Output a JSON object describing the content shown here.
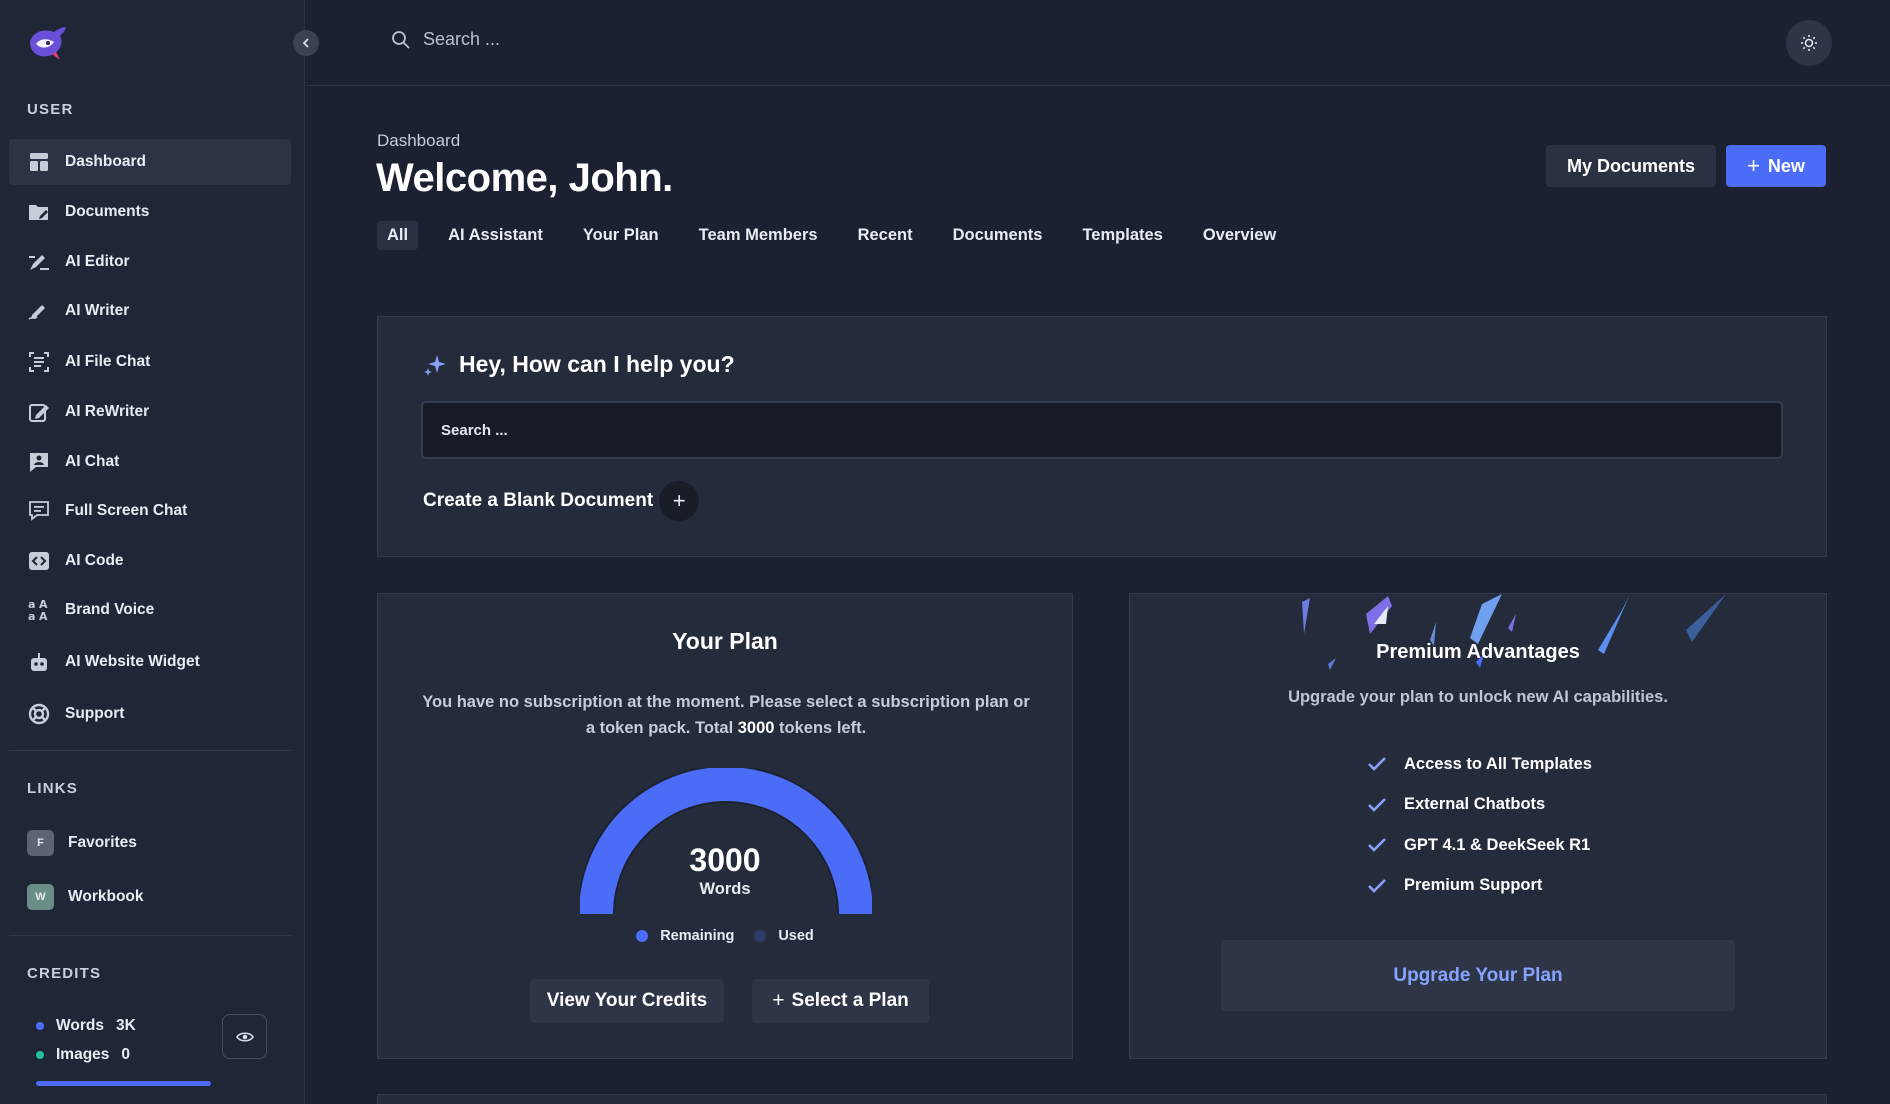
{
  "sidebar": {
    "user_title": "USER",
    "items": [
      {
        "label": "Dashboard",
        "icon": "dashboard-icon"
      },
      {
        "label": "Documents",
        "icon": "folder-icon"
      },
      {
        "label": "AI Editor",
        "icon": "editor-pen-icon"
      },
      {
        "label": "AI Writer",
        "icon": "writer-icon"
      },
      {
        "label": "AI File Chat",
        "icon": "file-chat-icon"
      },
      {
        "label": "AI ReWriter",
        "icon": "rewriter-icon"
      },
      {
        "label": "AI Chat",
        "icon": "chat-user-icon"
      },
      {
        "label": "Full Screen Chat",
        "icon": "fullscreen-chat-icon"
      },
      {
        "label": "AI Code",
        "icon": "code-icon"
      },
      {
        "label": "Brand Voice",
        "icon": "brand-voice-icon"
      },
      {
        "label": "AI Website Widget",
        "icon": "robot-icon"
      },
      {
        "label": "Support",
        "icon": "lifebuoy-icon"
      }
    ],
    "links_title": "LINKS",
    "links": [
      {
        "badge": "F",
        "label": "Favorites"
      },
      {
        "badge": "W",
        "label": "Workbook"
      }
    ],
    "credits_title": "CREDITS",
    "credits": [
      {
        "label": "Words",
        "value": "3K",
        "color": "#4a6cf7"
      },
      {
        "label": "Images",
        "value": "0",
        "color": "#22c39a"
      }
    ]
  },
  "topbar": {
    "search_placeholder": "Search ..."
  },
  "header": {
    "breadcrumb": "Dashboard",
    "welcome": "Welcome, John.",
    "my_documents": "My Documents",
    "new_label": "New"
  },
  "tabs": [
    "All",
    "AI Assistant",
    "Your Plan",
    "Team Members",
    "Recent",
    "Documents",
    "Templates",
    "Overview"
  ],
  "help": {
    "title": "Hey, How can I help you?",
    "search_placeholder": "Search ...",
    "blank_doc": "Create a Blank Document"
  },
  "plan": {
    "title": "Your Plan",
    "text_before": "You have no subscription at the moment. Please select a subscription plan or a token pack. Total ",
    "tokens": "3000",
    "text_after": " tokens left.",
    "gauge_value": "3000",
    "gauge_unit": "Words",
    "remaining_fraction": 1,
    "legend_remaining": "Remaining",
    "legend_used": "Used",
    "view_credits": "View Your Credits",
    "select_plan": "Select a Plan"
  },
  "premium": {
    "title": "Premium Advantages",
    "subtitle": "Upgrade your plan to unlock new AI capabilities.",
    "features": [
      "Access to All Templates",
      "External Chatbots",
      "GPT 4.1 & DeekSeek R1",
      "Premium Support"
    ],
    "upgrade": "Upgrade Your Plan"
  },
  "colors": {
    "accent": "#4a6cf7",
    "background": "#1b2130",
    "card": "#242b3b",
    "used": "#2d3a6b"
  }
}
